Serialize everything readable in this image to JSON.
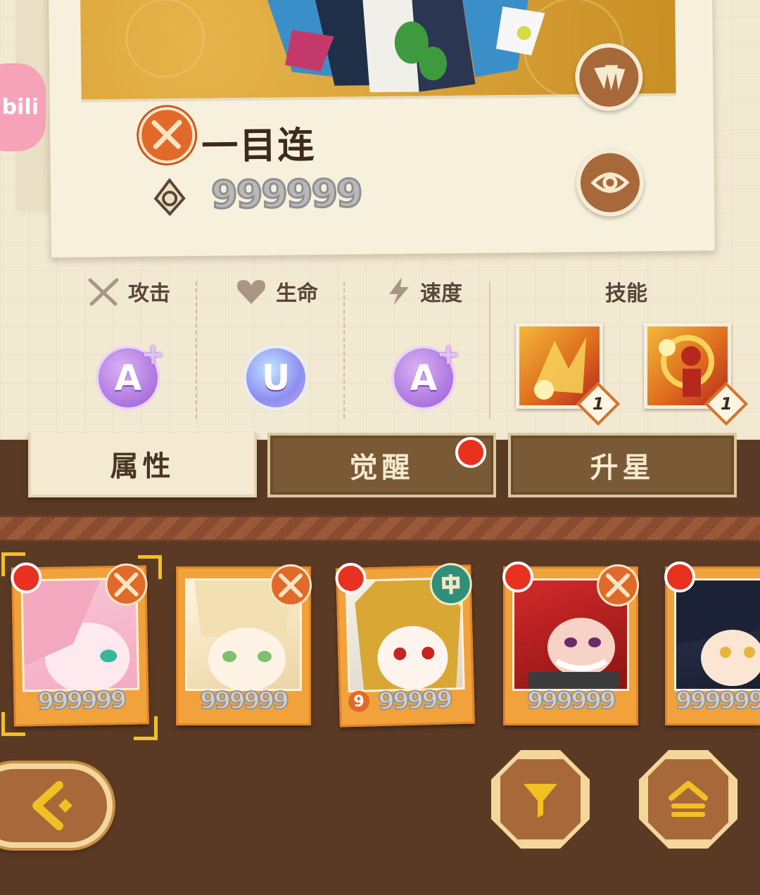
{
  "platform_badge": {
    "text": "bili"
  },
  "character": {
    "name": "一目连",
    "power": "999999",
    "class_icon": "crossed-swords-icon"
  },
  "side_buttons": [
    {
      "icon": "cards-icon"
    },
    {
      "icon": "eye-icon"
    }
  ],
  "stats": [
    {
      "label": "攻击",
      "icon": "crossed-swords-icon",
      "grade": "A",
      "plus": "+"
    },
    {
      "label": "生命",
      "icon": "heart-icon",
      "grade": "U",
      "plus": ""
    },
    {
      "label": "速度",
      "icon": "lightning-icon",
      "grade": "A",
      "plus": "+"
    }
  ],
  "skills": {
    "label": "技能",
    "items": [
      {
        "level": "1"
      },
      {
        "level": "1"
      }
    ]
  },
  "tabs": [
    {
      "label": "属性",
      "active": true,
      "notify": false
    },
    {
      "label": "觉醒",
      "active": false,
      "notify": true
    },
    {
      "label": "升星",
      "active": false,
      "notify": false
    }
  ],
  "heroes": [
    {
      "power": "999999",
      "class": "attack",
      "notify": true,
      "selected": true
    },
    {
      "power": "999999",
      "class": "attack",
      "notify": false,
      "selected": false
    },
    {
      "power": "99999",
      "badge": "9",
      "class": "support",
      "notify": true,
      "selected": false
    },
    {
      "power": "999999",
      "class": "attack",
      "notify": true,
      "selected": false
    },
    {
      "power": "999999",
      "class": "attack",
      "notify": true,
      "selected": false
    }
  ],
  "bottom_buttons": {
    "back": "back-arrow-icon",
    "filter": "filter-icon",
    "collapse": "collapse-icon"
  },
  "colors": {
    "paper": "#f2e9d3",
    "wood": "#5b3a25",
    "accent": "#e16a2a",
    "notify": "#e8321f"
  }
}
